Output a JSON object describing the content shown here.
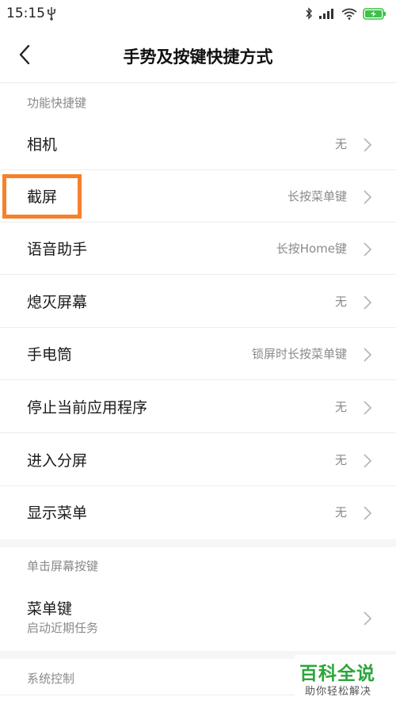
{
  "status_bar": {
    "time": "15:15",
    "icons": [
      "usb-icon",
      "bluetooth-icon",
      "signal-icon",
      "wifi-icon",
      "battery-charging-icon"
    ]
  },
  "header": {
    "title": "手势及按键快捷方式"
  },
  "sections": {
    "function_shortcuts": {
      "header": "功能快捷键",
      "items": [
        {
          "label": "相机",
          "value": "无"
        },
        {
          "label": "截屏",
          "value": "长按菜单键"
        },
        {
          "label": "语音助手",
          "value": "长按Home键"
        },
        {
          "label": "熄灭屏幕",
          "value": "无"
        },
        {
          "label": "手电筒",
          "value": "锁屏时长按菜单键"
        },
        {
          "label": "停止当前应用程序",
          "value": "无"
        },
        {
          "label": "进入分屏",
          "value": "无"
        },
        {
          "label": "显示菜单",
          "value": "无"
        }
      ]
    },
    "tap_screen_buttons": {
      "header": "单击屏幕按键",
      "items": [
        {
          "label": "菜单键",
          "subtitle": "启动近期任务"
        }
      ]
    },
    "system_control": {
      "header": "系统控制"
    }
  },
  "watermark": {
    "title": "百科全说",
    "subtitle": "助你轻松解决"
  },
  "colors": {
    "highlight": "#f7812a",
    "watermark": "#2aa63a",
    "battery": "#3cc14a"
  }
}
